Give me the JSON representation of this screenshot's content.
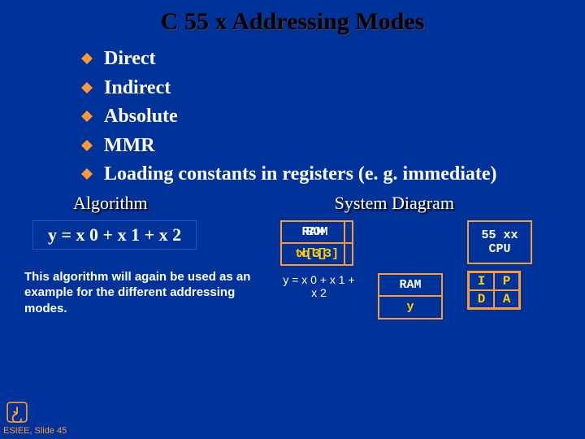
{
  "title": "C 55 x Addressing Modes",
  "bullets": [
    "Direct",
    "Indirect",
    "Absolute",
    "MMR",
    "Loading constants in registers (e. g. immediate)"
  ],
  "labels": {
    "algorithm": "Algorithm",
    "system_diagram": "System Diagram"
  },
  "formula": "y = x 0 + x 1 + x 2",
  "algo_desc": "This algorithm will again be used as an example for the different addressing modes.",
  "diagram": {
    "rom": {
      "title": "ROM",
      "sub": "tbl[3]"
    },
    "ram1": {
      "title": "RAM",
      "sub": "x[3]"
    },
    "cpu": {
      "line1": "55 xx",
      "line2": "CPU"
    },
    "eq_under": "y = x 0 + x 1 + x 2",
    "ram2": {
      "title": "RAM",
      "sub": "y"
    },
    "grid": {
      "tl": "I",
      "tr": "P",
      "bl": "D",
      "br": "A"
    }
  },
  "footer": "ESIEE, Slide 45"
}
